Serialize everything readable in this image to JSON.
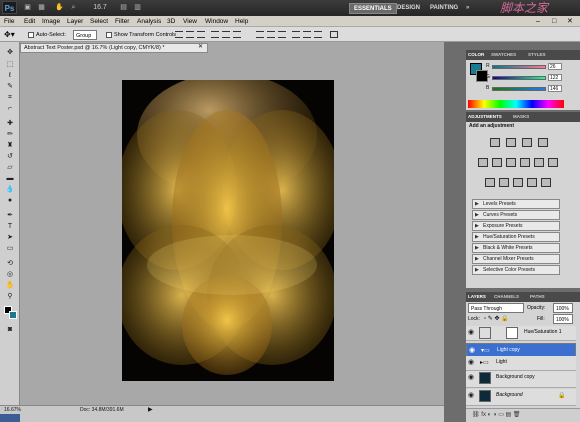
{
  "app": {
    "zoom": "16.7",
    "logo": "Ps",
    "watermark": "脚本之家"
  },
  "workspaces": [
    "ESSENTIALS",
    "DESIGN",
    "PAINTING"
  ],
  "menu": [
    "File",
    "Edit",
    "Image",
    "Layer",
    "Select",
    "Filter",
    "Analysis",
    "3D",
    "View",
    "Window",
    "Help"
  ],
  "options": {
    "auto_select": "Auto-Select:",
    "group": "Group",
    "show_transform": "Show Transform Controls"
  },
  "document": {
    "tab_title": "Abstract Text Poster.psd @ 16.7% (Light copy, CMYK/8) *"
  },
  "status": {
    "zoom": "16.67%",
    "doc": "Doc: 34.8M/391.6M"
  },
  "color_panel": {
    "tabs": [
      "COLOR",
      "SWATCHES",
      "STYLES"
    ],
    "r": "26",
    "g": "122",
    "b": "146",
    "fg": "#1a7a92"
  },
  "adjustments": {
    "tabs": [
      "ADJUSTMENTS",
      "MASKS"
    ],
    "title": "Add an adjustment",
    "presets": [
      "Levels Presets",
      "Curves Presets",
      "Exposure Presets",
      "Hue/Saturation Presets",
      "Black & White Presets",
      "Channel Mixer Presets",
      "Selective Color Presets"
    ]
  },
  "layers_panel": {
    "tabs": [
      "LAYERS",
      "CHANNELS",
      "PATHS"
    ],
    "blend": "Pass Through",
    "opacity_label": "Opacity:",
    "opacity": "100%",
    "lock_label": "Lock:",
    "fill_label": "Fill:",
    "fill": "100%",
    "layers": [
      {
        "name": "Hue/Saturation 1",
        "selected": false
      },
      {
        "name": "Light copy",
        "selected": true
      },
      {
        "name": "Light",
        "selected": false
      },
      {
        "name": "Background copy",
        "selected": false
      },
      {
        "name": "Background",
        "selected": false
      }
    ]
  }
}
